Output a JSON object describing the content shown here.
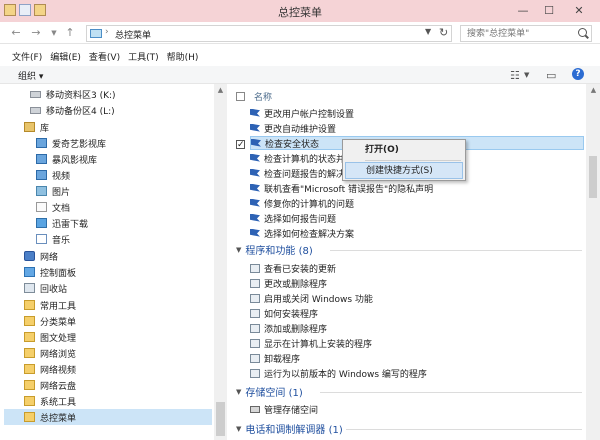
{
  "window": {
    "title": "总控菜单"
  },
  "address": {
    "path": "总控菜单",
    "search_placeholder": "搜索\"总控菜单\""
  },
  "menus": [
    "文件(F)",
    "编辑(E)",
    "查看(V)",
    "工具(T)",
    "帮助(H)"
  ],
  "toolbar": {
    "organize": "组织"
  },
  "nav": [
    {
      "label": "移动资料区3 (K:)",
      "icon": "drive-icon"
    },
    {
      "label": "移动备份区4 (L:)",
      "icon": "drive-icon"
    },
    {
      "label": "库",
      "icon": "library-icon"
    },
    {
      "label": "爱奇艺影视库",
      "icon": "video-library-icon"
    },
    {
      "label": "暴风影视库",
      "icon": "video-library-icon"
    },
    {
      "label": "视频",
      "icon": "video-icon"
    },
    {
      "label": "图片",
      "icon": "picture-icon"
    },
    {
      "label": "文档",
      "icon": "document-icon"
    },
    {
      "label": "迅雷下载",
      "icon": "download-icon"
    },
    {
      "label": "音乐",
      "icon": "music-icon"
    },
    {
      "label": "网络",
      "icon": "network-icon"
    },
    {
      "label": "控制面板",
      "icon": "control-panel-icon"
    },
    {
      "label": "回收站",
      "icon": "recycle-bin-icon"
    },
    {
      "label": "常用工具",
      "icon": "folder-icon"
    },
    {
      "label": "分类菜单",
      "icon": "folder-icon"
    },
    {
      "label": "图文处理",
      "icon": "folder-icon"
    },
    {
      "label": "网络浏览",
      "icon": "folder-icon"
    },
    {
      "label": "网络视频",
      "icon": "folder-icon"
    },
    {
      "label": "网络云盘",
      "icon": "folder-icon"
    },
    {
      "label": "系统工具",
      "icon": "folder-icon"
    },
    {
      "label": "总控菜单",
      "icon": "folder-icon",
      "selected": true
    }
  ],
  "content": {
    "header_name": "名称",
    "top_items": [
      {
        "label": "更改用户帐户控制设置",
        "icon": "flag-icon"
      },
      {
        "label": "更改自动维护设置",
        "icon": "flag-icon"
      },
      {
        "label": "检查安全状态",
        "icon": "flag-icon",
        "selected": true,
        "checked": true
      },
      {
        "label": "检查计算机的状态并",
        "icon": "flag-icon"
      },
      {
        "label": "检查问题报告的解决",
        "icon": "flag-icon"
      },
      {
        "label": "联机查看\"Microsoft 错误报告\"的隐私声明",
        "icon": "flag-icon"
      },
      {
        "label": "修复你的计算机的问题",
        "icon": "flag-icon"
      },
      {
        "label": "选择如何报告问题",
        "icon": "flag-icon"
      },
      {
        "label": "选择如何检查解决方案",
        "icon": "flag-icon"
      }
    ],
    "groups": [
      {
        "title": "程序和功能 (8)",
        "items": [
          "查看已安装的更新",
          "更改或删除程序",
          "启用或关闭 Windows 功能",
          "如何安装程序",
          "添加或删除程序",
          "显示在计算机上安装的程序",
          "卸载程序",
          "运行为以前版本的 Windows 编写的程序"
        ]
      },
      {
        "title": "存储空间 (1)",
        "items": [
          "管理存储空间"
        ]
      },
      {
        "title": "电话和调制解调器 (1)",
        "items": []
      }
    ]
  },
  "context_menu": {
    "items": [
      "打开(O)",
      "创建快捷方式(S)"
    ],
    "highlighted": 1
  }
}
